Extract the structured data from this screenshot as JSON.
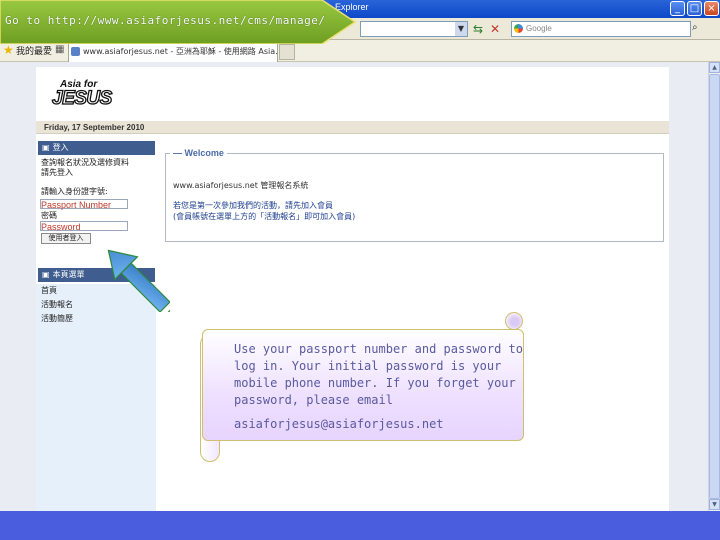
{
  "callout_url": "Go to http://www.asiaforjesus.net/cms/manage/",
  "browser": {
    "title_fragment": "Explorer",
    "search_placeholder": "Google",
    "favorites_label": "我的最愛",
    "tab_title": "www.asiaforjesus.net - 亞洲為耶穌 - 使用網路 Asia..."
  },
  "site": {
    "date": "Friday, 17 September 2010",
    "login_header": "登入",
    "intro_lines": [
      "查詢報名狀況及選修資料",
      "請先登入"
    ],
    "prompt": "請輸入身份證字號:",
    "passport_label": "Passport  Number",
    "password_caption": "密碼",
    "password_label": "Password",
    "login_button": "使用者登入",
    "menu_header": "本頁選單",
    "menu_items": [
      "首頁",
      "活動報名",
      "活動簡歷"
    ],
    "welcome_title": "Welcome",
    "welcome_lines": [
      "www.asiaforjesus.net 管理報名系統",
      "若您是第一次參加我們的活動，請先加入會員",
      "(會員帳號在選單上方的「活動報名」即可加入會員)"
    ]
  },
  "note": {
    "text": "Use your passport number and password to log in. Your initial password is your mobile phone number. If you forget your password, please email",
    "email": "asiaforjesus@asiaforjesus.net"
  },
  "colors": {
    "callout_green": "#7aae28",
    "arrow_blue": "#5a9ee0",
    "bottom_band": "#4a5ddf"
  }
}
